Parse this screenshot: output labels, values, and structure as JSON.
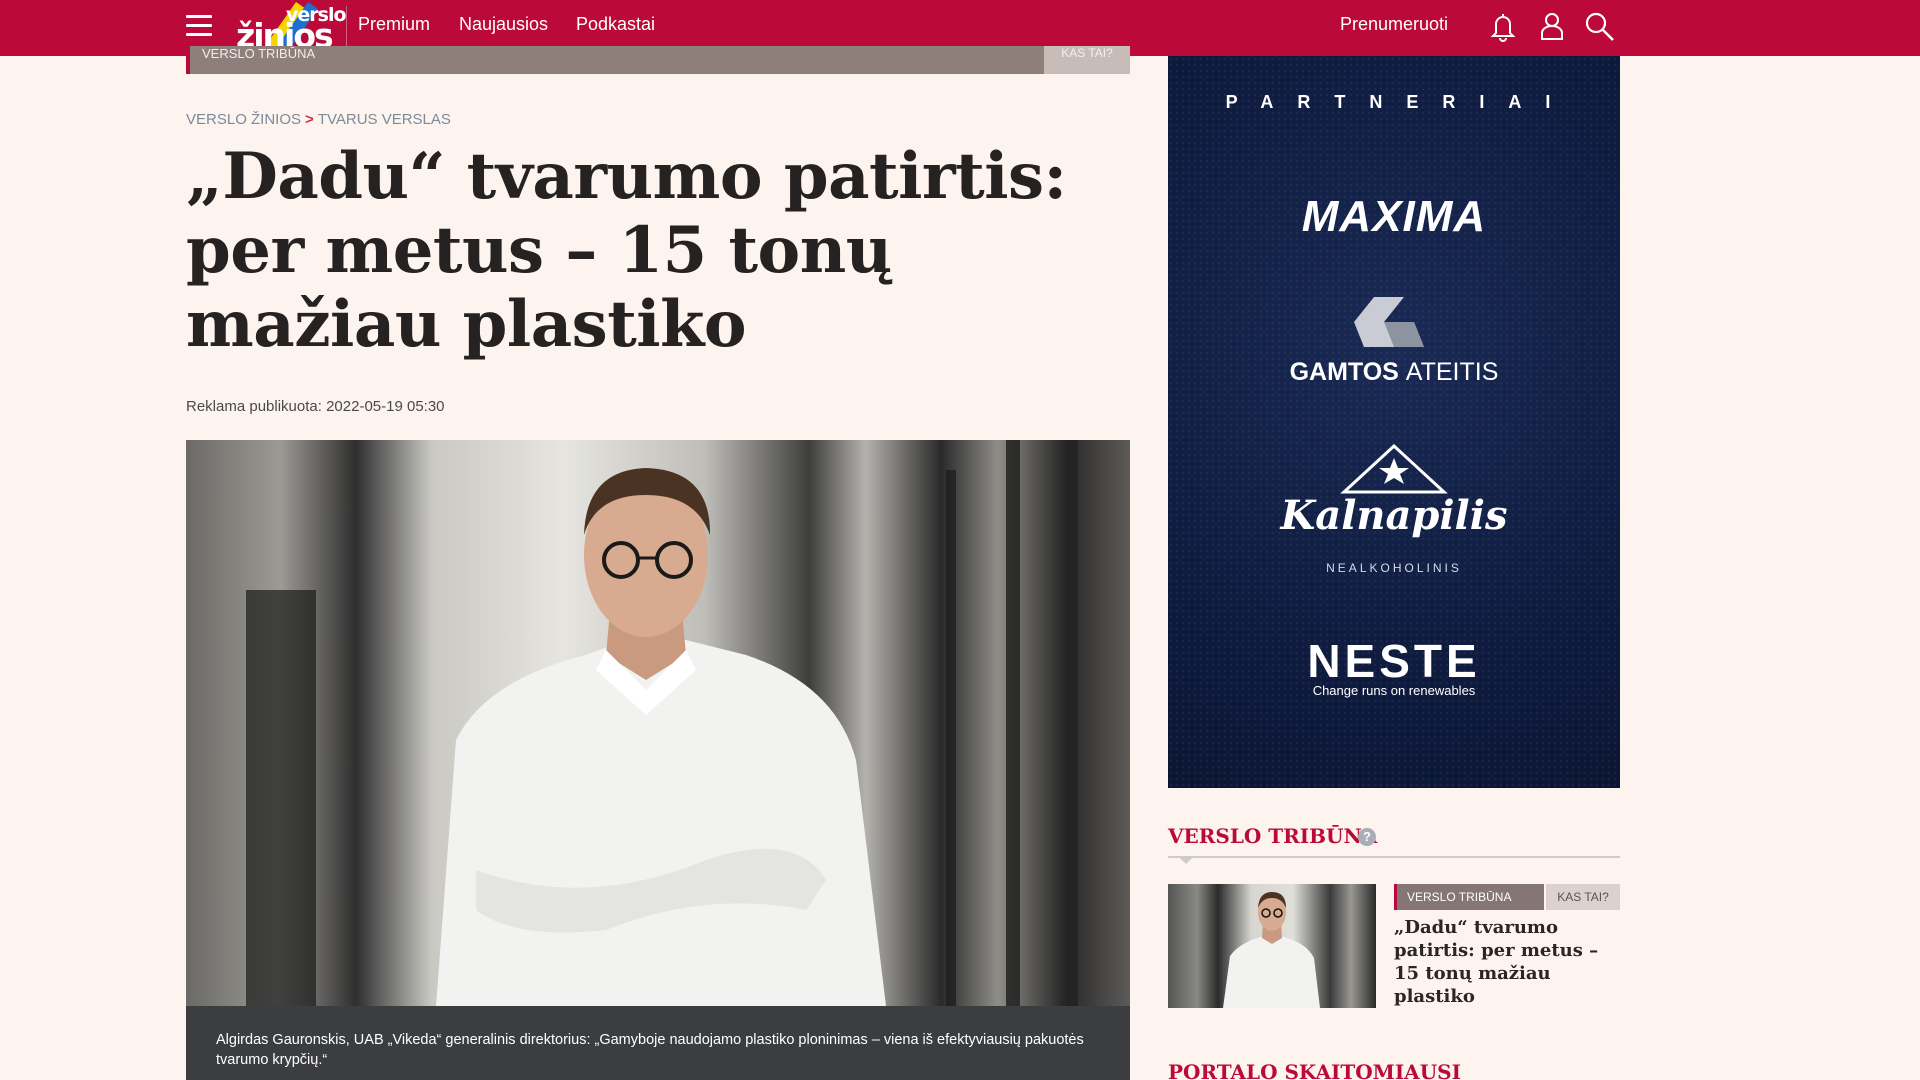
{
  "nav": {
    "logo_top": "verslo",
    "logo_bottom": "žinios",
    "links": [
      "Premium",
      "Naujausios",
      "Podkastai"
    ],
    "subscribe": "Prenumeruoti",
    "icons": [
      "menu-icon",
      "bell-icon",
      "user-icon",
      "search-icon"
    ],
    "brand_color": "#bb0a3a"
  },
  "strip": {
    "label": "VERSLO TRIBŪNA",
    "right": "KAS TAI?"
  },
  "breadcrumb": {
    "root": "VERSLO ŽINIOS",
    "separator": ">",
    "section": "TVARUS VERSLAS"
  },
  "article": {
    "title": "„Dadu“ tvarumo patirtis: per metus – 15 tonų mažiau plastiko",
    "meta": "Reklama publikuota: 2022-05-19 05:30",
    "caption": "Algirdas Gauronskis, UAB „Vikeda“ generalinis direktorius: „Gamyboje naudojamo plastiko ploninimas – viena iš efektyviausių pakuotės tvarumo krypčių.“"
  },
  "partners": {
    "heading": "PARTNERIAI",
    "maxima": "MAXIMA",
    "gamtos_bold": "GAMTOS",
    "gamtos_light": "ATEITIS",
    "kalnapilis": "Kalnapilis",
    "kalnapilis_sub": "NEALKOHOLINIS",
    "neste": "NESTE",
    "neste_sub": "Change runs on renewables"
  },
  "sidebar": {
    "tribuna_heading": "VERSLO TRIBŪNA",
    "help": "?",
    "tag": "VERSLO TRIBŪNA",
    "tag_right": "KAS TAI?",
    "item_title": "„Dadu“ tvarumo patirtis: per metus – 15 tonų mažiau plastiko",
    "popular_heading": "PORTALO SKAITOMIAUSI"
  }
}
